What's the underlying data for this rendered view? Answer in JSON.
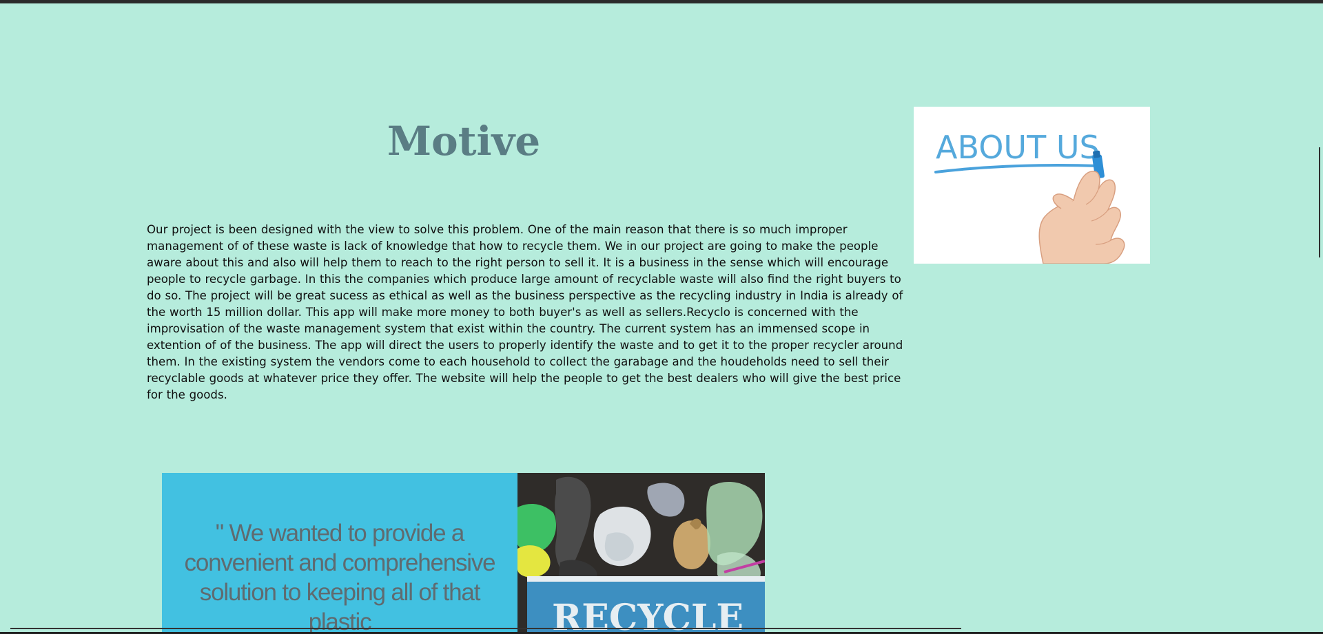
{
  "motive": {
    "title": "Motive",
    "paragraph": "Our project is been designed with the view to solve this problem. One of the main reason that there is so much improper management of of these waste is lack of knowledge that how to recycle them. We in our project are going to make the people aware about this and also will help them to reach to the right person to sell it. It is a business in the sense which will encourage people to recycle garbage. In this the companies which produce large amount of recyclable waste will also find the right buyers to do so. The project will be great sucess as ethical as well as the business perspective as the recycling industry in India is already of the worth 15 million dollar. This app will make more money to both buyer's as well as sellers.Recyclo is concerned with the improvisation of the waste management system that exist within the country. The current system has an immensed scope in extention of of the business. The app will direct the users to properly identify the waste and to get it to the proper recycler around them. In the existing system the vendors come to each household to collect the garabage and the houdeholds need to sell their recyclable goods at whatever price they offer. The website will help the people to get the best dealers who will give the best price for the goods."
  },
  "about_image": {
    "text": "ABOUT US",
    "icon": "hand-with-marker-icon"
  },
  "quote": {
    "text": "\" We wanted to provide a convenient and comprehensive solution to keeping all of that plastic"
  },
  "recycle_photo": {
    "label": "RECYCLE",
    "icon": "plastic-waste-photo"
  },
  "colors": {
    "page_background": "#b6ecdc",
    "title": "#5a7d84",
    "quote_panel": "#42c1e1",
    "quote_text": "#5f6b70",
    "about_us_blue": "#55a9dc"
  }
}
